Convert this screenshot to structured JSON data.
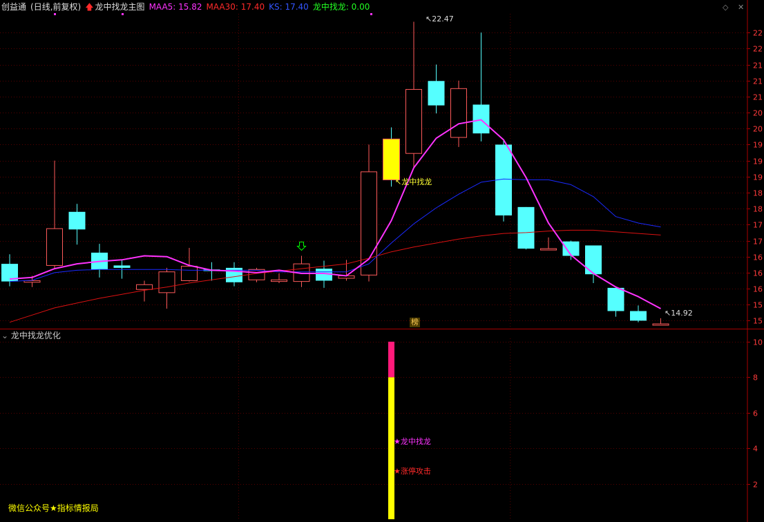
{
  "header": {
    "app_name": "创益通",
    "period": "(日线,前复权)",
    "indicator_name": "龙中找龙主图",
    "maa5": "MAA5: 15.82",
    "maa30": "MAA30: 17.40",
    "ks": "KS: 17.40",
    "signal": "龙中找龙: 0.00"
  },
  "sub_panel": {
    "title": "龙中找龙优化",
    "label_dragon": "★龙中找龙",
    "label_limit_up": "★涨停攻击",
    "footer": "微信公众号★指标情报局"
  },
  "colors": {
    "up": "#ff5a5a",
    "down": "#55ffff",
    "maa5": "#ff33ff",
    "maa30": "#dd1111",
    "ks": "#1a2aff",
    "highlight": "#ffff00",
    "signal_green": "#00ff00",
    "sub_bar_top": "#ff1a7a",
    "grid": "#5a0000"
  },
  "icons": {
    "signal_arrow": "hollow-down-arrow-icon",
    "header_arrow": "red-up-arrow-icon",
    "bang_badge": "bang-badge-icon"
  },
  "chart_data": [
    {
      "type": "candlestick",
      "title": "龙中找龙主图",
      "ylim": [
        14.8,
        22.6
      ],
      "y_ticks": [
        15.0,
        15.4,
        15.8,
        16.2,
        16.6,
        17.0,
        17.4,
        17.8,
        18.2,
        18.6,
        19.0,
        19.4,
        19.8,
        20.2,
        20.6,
        21.0,
        21.4,
        21.8,
        22.2
      ],
      "y_tick_labels": [
        "15",
        "15",
        "16",
        "16",
        "16",
        "17",
        "17",
        "18",
        "18",
        "19",
        "19",
        "19",
        "20",
        "20",
        "21",
        "21",
        "21",
        "22",
        "22"
      ],
      "candles": [
        {
          "o": 16.42,
          "h": 16.66,
          "l": 15.86,
          "c": 15.98
        },
        {
          "o": 15.96,
          "h": 16.12,
          "l": 15.84,
          "c": 16.0
        },
        {
          "o": 16.38,
          "h": 19.0,
          "l": 16.3,
          "c": 17.3
        },
        {
          "o": 17.72,
          "h": 17.92,
          "l": 16.9,
          "c": 17.28
        },
        {
          "o": 16.7,
          "h": 16.92,
          "l": 16.08,
          "c": 16.28
        },
        {
          "o": 16.38,
          "h": 16.52,
          "l": 16.05,
          "c": 16.32
        },
        {
          "o": 15.78,
          "h": 16.0,
          "l": 15.48,
          "c": 15.9
        },
        {
          "o": 15.7,
          "h": 16.32,
          "l": 15.3,
          "c": 16.22
        },
        {
          "o": 16.0,
          "h": 16.82,
          "l": 15.98,
          "c": 16.36
        },
        {
          "o": 16.28,
          "h": 16.46,
          "l": 16.0,
          "c": 16.24
        },
        {
          "o": 16.32,
          "h": 16.46,
          "l": 15.86,
          "c": 15.96
        },
        {
          "o": 16.02,
          "h": 16.32,
          "l": 15.96,
          "c": 16.28
        },
        {
          "o": 15.98,
          "h": 16.18,
          "l": 15.94,
          "c": 16.02
        },
        {
          "o": 15.98,
          "h": 16.62,
          "l": 15.84,
          "c": 16.42
        },
        {
          "o": 16.3,
          "h": 16.5,
          "l": 15.82,
          "c": 16.0
        },
        {
          "o": 16.06,
          "h": 16.52,
          "l": 16.0,
          "c": 16.12
        },
        {
          "o": 16.14,
          "h": 19.4,
          "l": 15.98,
          "c": 18.72
        },
        {
          "o": 19.54,
          "h": 19.83,
          "l": 18.35,
          "c": 18.52,
          "highlight": true
        },
        {
          "o": 19.18,
          "h": 22.47,
          "l": 18.82,
          "c": 20.78
        },
        {
          "o": 20.99,
          "h": 21.4,
          "l": 20.18,
          "c": 20.38
        },
        {
          "o": 19.58,
          "h": 21.0,
          "l": 19.34,
          "c": 20.8
        },
        {
          "o": 20.4,
          "h": 22.2,
          "l": 19.48,
          "c": 19.68
        },
        {
          "o": 19.4,
          "h": 19.52,
          "l": 17.48,
          "c": 17.63
        },
        {
          "o": 17.84,
          "h": 17.84,
          "l": 16.78,
          "c": 16.8
        },
        {
          "o": 16.8,
          "h": 17.08,
          "l": 16.78,
          "c": 16.8
        },
        {
          "o": 16.98,
          "h": 17.0,
          "l": 16.52,
          "c": 16.62
        },
        {
          "o": 16.88,
          "h": 16.88,
          "l": 15.94,
          "c": 16.16
        },
        {
          "o": 15.82,
          "h": 15.82,
          "l": 15.1,
          "c": 15.24
        },
        {
          "o": 15.24,
          "h": 15.38,
          "l": 14.96,
          "c": 15.0
        },
        {
          "o": 14.92,
          "h": 15.06,
          "l": 14.92,
          "c": 14.92
        }
      ],
      "maa5": [
        16.04,
        16.08,
        16.3,
        16.42,
        16.48,
        16.52,
        16.62,
        16.6,
        16.38,
        16.26,
        16.24,
        16.2,
        16.26,
        16.18,
        16.18,
        16.12,
        16.54,
        17.5,
        18.82,
        19.56,
        19.92,
        20.02,
        19.52,
        18.58,
        17.44,
        16.64,
        16.18,
        15.84,
        15.6,
        15.3
      ],
      "maa30": [
        14.96,
        15.14,
        15.32,
        15.44,
        15.56,
        15.66,
        15.76,
        15.84,
        15.94,
        16.02,
        16.1,
        16.18,
        16.24,
        16.3,
        16.36,
        16.42,
        16.56,
        16.72,
        16.84,
        16.94,
        17.04,
        17.12,
        17.18,
        17.2,
        17.24,
        17.26,
        17.26,
        17.22,
        17.18,
        17.14
      ],
      "ks": [
        15.98,
        16.01,
        16.2,
        16.26,
        16.28,
        16.28,
        16.28,
        16.28,
        16.26,
        16.26,
        16.26,
        16.26,
        16.22,
        16.22,
        16.22,
        16.22,
        16.42,
        16.94,
        17.42,
        17.82,
        18.16,
        18.46,
        18.54,
        18.52,
        18.52,
        18.4,
        18.1,
        17.6,
        17.44,
        17.34
      ],
      "annotations": {
        "high_label": "22.47",
        "low_label": "14.92",
        "signal_label": "龙中找龙",
        "bang_label": "榜"
      }
    },
    {
      "type": "bar",
      "title": "龙中找龙优化",
      "ylim": [
        0,
        10.5
      ],
      "y_ticks": [
        2,
        4,
        6,
        8,
        10
      ],
      "y_tick_labels": [
        "2",
        "4",
        "6",
        "8",
        "10"
      ],
      "bar_index": 17,
      "segments": [
        {
          "name": "★涨停攻击",
          "from": 0,
          "to": 8,
          "color": "#ffff00"
        },
        {
          "name": "★龙中找龙",
          "from": 8,
          "to": 10,
          "color": "#ff1a7a"
        }
      ]
    }
  ]
}
